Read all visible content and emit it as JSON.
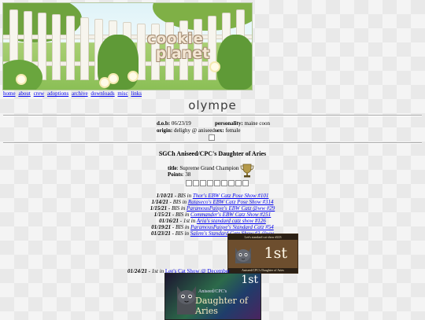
{
  "banner": {
    "logo_line1": "cookie",
    "logo_line2": "planet"
  },
  "nav": [
    "home",
    "about",
    "crew",
    "adoptions",
    "archive",
    "downloads",
    "misc",
    "links"
  ],
  "site_title": "olympe",
  "info": {
    "dob_label": "d.o.b:",
    "dob": "06/23/19",
    "personality_label": "personality:",
    "personality": "maine coon",
    "origin_label": "origin:",
    "origin": "delighy @ aniseed",
    "sex_label": "sex:",
    "sex": "female"
  },
  "cat_title": "SGCh Aniseed/CPC's Daughter of Aries",
  "title_label": "title",
  "title_value": "Supreme Grand Champion",
  "points_label": "Points",
  "points_value": "38",
  "results": [
    {
      "date": "1/10/21",
      "text": " - BIS in ",
      "link": "Thor's EBW Catz Pose Show #101"
    },
    {
      "date": "1/14/21",
      "text": " - BIS in ",
      "link": "Rataseco's EBW Catz Pose Show #314"
    },
    {
      "date": "1/15/21",
      "text": " - BIS in ",
      "link": "ParamousPaisye's EBW Catz @ww #29"
    },
    {
      "date": "1/15/21",
      "text": " - BIS in ",
      "link": "Commander's EBW Catz Show #251"
    },
    {
      "date": "01/16/21",
      "text": " - 1st in ",
      "link": "Aria's standard catz show #126"
    },
    {
      "date": "01/19/21",
      "text": " - BIS in ",
      "link": "ParamousPaisye's Standard Catz #54"
    },
    {
      "date": "01/23/21",
      "text": " - BIS in ",
      "link": "Salem's Standard Catz Show #3 @ww"
    }
  ],
  "card1": {
    "header": "Lee's standard cat show #223",
    "place": "1st",
    "footer": "Aniseed/CPC's Daughter of Aries"
  },
  "late_result": {
    "date": "01/24/21",
    "text": " - 1st in ",
    "link": "Lee's Cat Show @ December"
  },
  "card2": {
    "place": "1st",
    "line1": "Aniseed/CPC's",
    "line2": "Daughter of Aries"
  }
}
